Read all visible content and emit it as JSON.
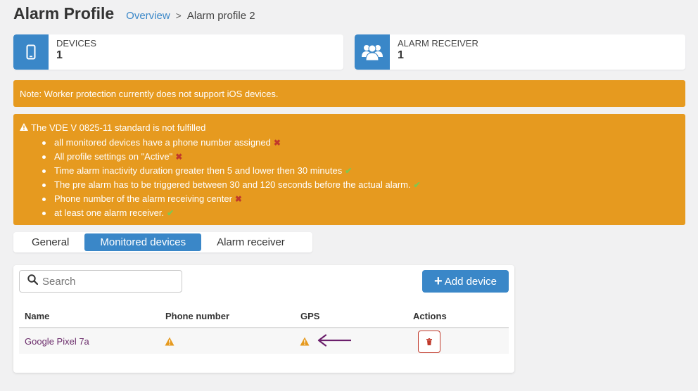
{
  "header": {
    "title": "Alarm Profile",
    "breadcrumb_link": "Overview",
    "breadcrumb_separator": ">",
    "breadcrumb_current": "Alarm profile 2"
  },
  "stats": [
    {
      "label": "DEVICES",
      "value": "1",
      "icon": "smartphone-icon"
    },
    {
      "label": "ALARM RECEIVER",
      "value": "1",
      "icon": "users-icon"
    }
  ],
  "note": "Note: Worker protection currently does not support iOS devices.",
  "warning": {
    "title": "The VDE V 0825-11 standard is not fulfilled",
    "items": [
      {
        "text": "all monitored devices have a phone number assigned",
        "mark": "✖"
      },
      {
        "text": "All profile settings on \"Active\"",
        "mark": "✖"
      },
      {
        "text": "Time alarm inactivity duration greater then 5 and lower then 30 minutes",
        "mark": "✔"
      },
      {
        "text": "The pre alarm has to be triggered between 30 and 120 seconds before the actual alarm.",
        "mark": "✔"
      },
      {
        "text": "Phone number of the alarm receiving center",
        "mark": "✖"
      },
      {
        "text": "at least one alarm receiver.",
        "mark": "✔"
      }
    ]
  },
  "tabs": [
    {
      "label": "General",
      "active": false
    },
    {
      "label": "Monitored devices",
      "active": true
    },
    {
      "label": "Alarm receiver",
      "active": false
    }
  ],
  "search": {
    "placeholder": "Search",
    "value": ""
  },
  "add_button": {
    "label": "Add device"
  },
  "table": {
    "columns": [
      "Name",
      "Phone number",
      "GPS",
      "Actions"
    ],
    "rows": [
      {
        "name": "Google Pixel 7a",
        "phone_status": "warning-icon",
        "gps_status": "warning-icon",
        "action": "delete-icon"
      }
    ]
  },
  "colors": {
    "primary": "#3a87c8",
    "warning_banner": "#e69a1f",
    "fail_mark": "#c0392b",
    "ok_mark": "#7ec850",
    "annotation_arrow": "#6b1f6b"
  }
}
